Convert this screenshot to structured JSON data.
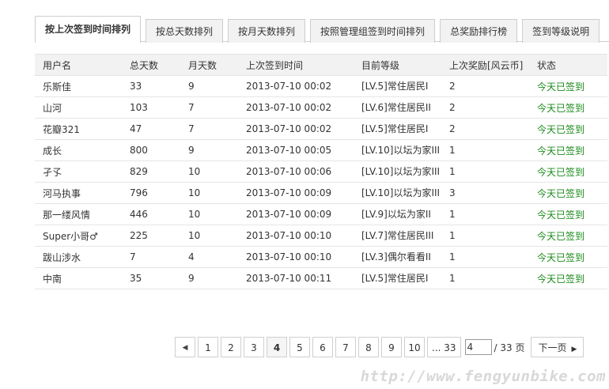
{
  "tabs": [
    {
      "label": "按上次签到时间排列",
      "active": true
    },
    {
      "label": "按总天数排列",
      "active": false
    },
    {
      "label": "按月天数排列",
      "active": false
    },
    {
      "label": "按照管理组签到时间排列",
      "active": false
    },
    {
      "label": "总奖励排行榜",
      "active": false
    },
    {
      "label": "签到等级说明",
      "active": false
    }
  ],
  "table": {
    "headers": [
      "用户名",
      "总天数",
      "月天数",
      "上次签到时间",
      "目前等级",
      "上次奖励[风云币]",
      "状态"
    ],
    "rows": [
      {
        "user": "乐斯佳",
        "total": "33",
        "month": "9",
        "time": "2013-07-10 00:02",
        "level": "[LV.5]常住居民I",
        "reward": "2",
        "status": "今天已签到"
      },
      {
        "user": "山河",
        "total": "103",
        "month": "7",
        "time": "2013-07-10 00:02",
        "level": "[LV.6]常住居民II",
        "reward": "2",
        "status": "今天已签到"
      },
      {
        "user": "花瓣321",
        "total": "47",
        "month": "7",
        "time": "2013-07-10 00:02",
        "level": "[LV.5]常住居民I",
        "reward": "2",
        "status": "今天已签到"
      },
      {
        "user": "成长",
        "total": "800",
        "month": "9",
        "time": "2013-07-10 00:05",
        "level": "[LV.10]以坛为家III",
        "reward": "1",
        "status": "今天已签到"
      },
      {
        "user": "孑孓",
        "total": "829",
        "month": "10",
        "time": "2013-07-10 00:06",
        "level": "[LV.10]以坛为家III",
        "reward": "1",
        "status": "今天已签到"
      },
      {
        "user": "河马执事",
        "total": "796",
        "month": "10",
        "time": "2013-07-10 00:09",
        "level": "[LV.10]以坛为家III",
        "reward": "3",
        "status": "今天已签到"
      },
      {
        "user": "那一缕风情",
        "total": "446",
        "month": "10",
        "time": "2013-07-10 00:09",
        "level": "[LV.9]以坛为家II",
        "reward": "1",
        "status": "今天已签到"
      },
      {
        "user": "Super小哥♂",
        "total": "225",
        "month": "10",
        "time": "2013-07-10 00:10",
        "level": "[LV.7]常住居民III",
        "reward": "1",
        "status": "今天已签到"
      },
      {
        "user": "跋山涉水",
        "total": "7",
        "month": "4",
        "time": "2013-07-10 00:10",
        "level": "[LV.3]偶尔看看II",
        "reward": "1",
        "status": "今天已签到"
      },
      {
        "user": "中南",
        "total": "35",
        "month": "9",
        "time": "2013-07-10 00:11",
        "level": "[LV.5]常住居民I",
        "reward": "1",
        "status": "今天已签到"
      }
    ]
  },
  "pager": {
    "prev_icon": "chevron-left-icon",
    "pages": [
      "1",
      "2",
      "3",
      "4",
      "5",
      "6",
      "7",
      "8",
      "9",
      "10"
    ],
    "current": "4",
    "last_label": "... 33",
    "input_value": "4",
    "total_label": "/ 33 页",
    "next_label": "下一页",
    "next_icon": "chevron-right-icon"
  },
  "watermark": "http://www.fengyunbike.com",
  "colors": {
    "status": "#1a8a1a",
    "header_bg": "#f2f2f2",
    "tab_bg": "#f2f2f2"
  }
}
